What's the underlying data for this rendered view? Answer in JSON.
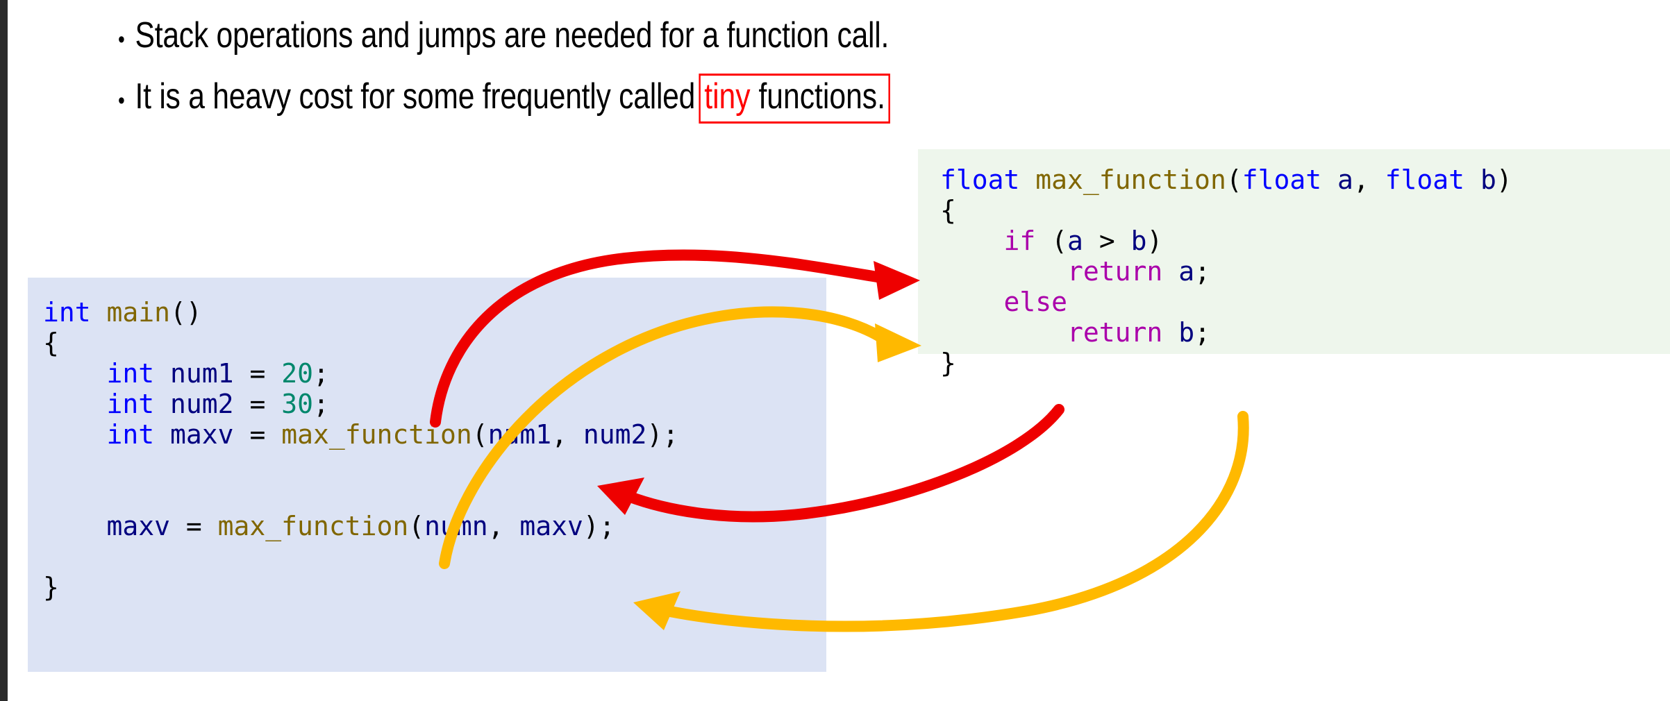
{
  "slide": {
    "bullets": [
      {
        "marker": "•",
        "text": "Stack operations and jumps are needed for a function call."
      },
      {
        "marker": "•",
        "text_before": "It is a heavy cost for some frequently called ",
        "highlight_word": "tiny",
        "text_after": " functions."
      }
    ]
  },
  "code_main": {
    "title": "int main()",
    "lines": [
      [
        {
          "t": "int",
          "c": "kw"
        },
        {
          "t": " ",
          "c": "punct"
        },
        {
          "t": "main",
          "c": "fn"
        },
        {
          "t": "()",
          "c": "punct"
        }
      ],
      [
        {
          "t": "{",
          "c": "punct"
        }
      ],
      [
        {
          "t": "    ",
          "c": "punct"
        },
        {
          "t": "int",
          "c": "kw"
        },
        {
          "t": " ",
          "c": "punct"
        },
        {
          "t": "num1",
          "c": "var"
        },
        {
          "t": " = ",
          "c": "op"
        },
        {
          "t": "20",
          "c": "num"
        },
        {
          "t": ";",
          "c": "punct"
        }
      ],
      [
        {
          "t": "    ",
          "c": "punct"
        },
        {
          "t": "int",
          "c": "kw"
        },
        {
          "t": " ",
          "c": "punct"
        },
        {
          "t": "num2",
          "c": "var"
        },
        {
          "t": " = ",
          "c": "op"
        },
        {
          "t": "30",
          "c": "num"
        },
        {
          "t": ";",
          "c": "punct"
        }
      ],
      [
        {
          "t": "    ",
          "c": "punct"
        },
        {
          "t": "int",
          "c": "kw"
        },
        {
          "t": " ",
          "c": "punct"
        },
        {
          "t": "maxv",
          "c": "var"
        },
        {
          "t": " = ",
          "c": "op"
        },
        {
          "t": "max_function",
          "c": "fn"
        },
        {
          "t": "(",
          "c": "punct"
        },
        {
          "t": "num1",
          "c": "var"
        },
        {
          "t": ", ",
          "c": "punct"
        },
        {
          "t": "num2",
          "c": "var"
        },
        {
          "t": ");",
          "c": "punct"
        }
      ],
      [
        {
          "t": "",
          "c": "punct"
        }
      ],
      [
        {
          "t": "",
          "c": "punct"
        }
      ],
      [
        {
          "t": "    ",
          "c": "punct"
        },
        {
          "t": "maxv",
          "c": "var"
        },
        {
          "t": " = ",
          "c": "op"
        },
        {
          "t": "max_function",
          "c": "fn"
        },
        {
          "t": "(",
          "c": "punct"
        },
        {
          "t": "numn",
          "c": "var"
        },
        {
          "t": ", ",
          "c": "punct"
        },
        {
          "t": "maxv",
          "c": "var"
        },
        {
          "t": ");",
          "c": "punct"
        }
      ],
      [
        {
          "t": "",
          "c": "punct"
        }
      ],
      [
        {
          "t": "}",
          "c": "punct"
        }
      ]
    ]
  },
  "code_maxfn": {
    "title": "float max_function(float a, float b)",
    "lines": [
      [
        {
          "t": "float",
          "c": "kw"
        },
        {
          "t": " ",
          "c": "punct"
        },
        {
          "t": "max_function",
          "c": "fn"
        },
        {
          "t": "(",
          "c": "punct"
        },
        {
          "t": "float",
          "c": "kw"
        },
        {
          "t": " ",
          "c": "punct"
        },
        {
          "t": "a",
          "c": "var"
        },
        {
          "t": ", ",
          "c": "punct"
        },
        {
          "t": "float",
          "c": "kw"
        },
        {
          "t": " ",
          "c": "punct"
        },
        {
          "t": "b",
          "c": "var"
        },
        {
          "t": ")",
          "c": "punct"
        }
      ],
      [
        {
          "t": "{",
          "c": "punct"
        }
      ],
      [
        {
          "t": "    ",
          "c": "punct"
        },
        {
          "t": "if",
          "c": "ctrl"
        },
        {
          "t": " (",
          "c": "punct"
        },
        {
          "t": "a",
          "c": "var"
        },
        {
          "t": " > ",
          "c": "op"
        },
        {
          "t": "b",
          "c": "var"
        },
        {
          "t": ")",
          "c": "punct"
        }
      ],
      [
        {
          "t": "        ",
          "c": "punct"
        },
        {
          "t": "return",
          "c": "ctrl"
        },
        {
          "t": " ",
          "c": "punct"
        },
        {
          "t": "a",
          "c": "var"
        },
        {
          "t": ";",
          "c": "punct"
        }
      ],
      [
        {
          "t": "    ",
          "c": "punct"
        },
        {
          "t": "else",
          "c": "ctrl"
        }
      ],
      [
        {
          "t": "        ",
          "c": "punct"
        },
        {
          "t": "return",
          "c": "ctrl"
        },
        {
          "t": " ",
          "c": "punct"
        },
        {
          "t": "b",
          "c": "var"
        },
        {
          "t": ";",
          "c": "punct"
        }
      ],
      [
        {
          "t": "}",
          "c": "punct"
        }
      ]
    ]
  },
  "arrows": [
    {
      "name": "call-arrow-first",
      "color": "#ee0000",
      "meaning": "first call jumps from main into max_function"
    },
    {
      "name": "return-arrow-first",
      "color": "#ee0000",
      "meaning": "first return jumps back into main"
    },
    {
      "name": "call-arrow-second",
      "color": "#ffb900",
      "meaning": "second call jumps from main into max_function"
    },
    {
      "name": "return-arrow-second",
      "color": "#ffb900",
      "meaning": "second return jumps back into main"
    }
  ],
  "colors": {
    "code_main_bg": "#dce3f4",
    "code_maxfn_bg": "#eef6ec",
    "highlight_red": "#ff0000",
    "arrow_red": "#ee0000",
    "arrow_orange": "#ffb900",
    "keyword_blue": "#0000ff",
    "function_olive": "#806600",
    "identifier_navy": "#00007f",
    "number_green": "#00876c",
    "control_magenta": "#aa00aa"
  }
}
